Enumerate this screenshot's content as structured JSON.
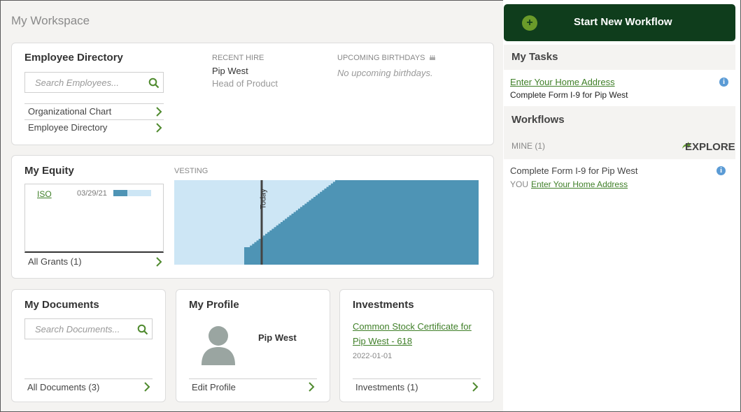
{
  "page": {
    "title": "My Workspace"
  },
  "employee_directory": {
    "title": "Employee Directory",
    "search_placeholder": "Search Employees...",
    "links": [
      "Organizational Chart",
      "Employee Directory"
    ],
    "recent_hire": {
      "label": "RECENT HIRE",
      "name": "Pip West",
      "role": "Head of Product"
    },
    "birthdays": {
      "label": "UPCOMING BIRTHDAYS",
      "empty": "No upcoming birthdays."
    }
  },
  "equity": {
    "title": "My Equity",
    "vesting_label": "VESTING",
    "grant": {
      "type": "ISO",
      "date": "03/29/21",
      "vested_fraction": 0.37
    },
    "all_grants": "All Grants (1)",
    "today_label": "Today"
  },
  "documents": {
    "title": "My Documents",
    "search_placeholder": "Search Documents...",
    "all_documents": "All Documents (3)"
  },
  "profile": {
    "title": "My Profile",
    "name": "Pip West",
    "edit": "Edit Profile"
  },
  "investments": {
    "title": "Investments",
    "link_line1": "Common Stock Certificate for",
    "link_line2": "Pip West - 618",
    "date": "2022-01-01",
    "all": "Investments (1)"
  },
  "right_panel": {
    "new_workflow": "Start New Workflow",
    "tasks": {
      "title": "My Tasks",
      "task_link": "Enter Your Home Address",
      "task_sub": "Complete Form I-9 for Pip West"
    },
    "workflows": {
      "title": "Workflows",
      "mine": "MINE (1)",
      "explore": "EXPLORE",
      "item_title": "Complete Form I-9 for Pip West",
      "item_you": "YOU",
      "item_link": "Enter Your Home Address"
    }
  },
  "colors": {
    "accent_green": "#3f7f28",
    "dark_green": "#0f3d1c",
    "vesting_dark": "#4e94b5",
    "vesting_light": "#cde6f5",
    "info_blue": "#5b9bd5"
  }
}
